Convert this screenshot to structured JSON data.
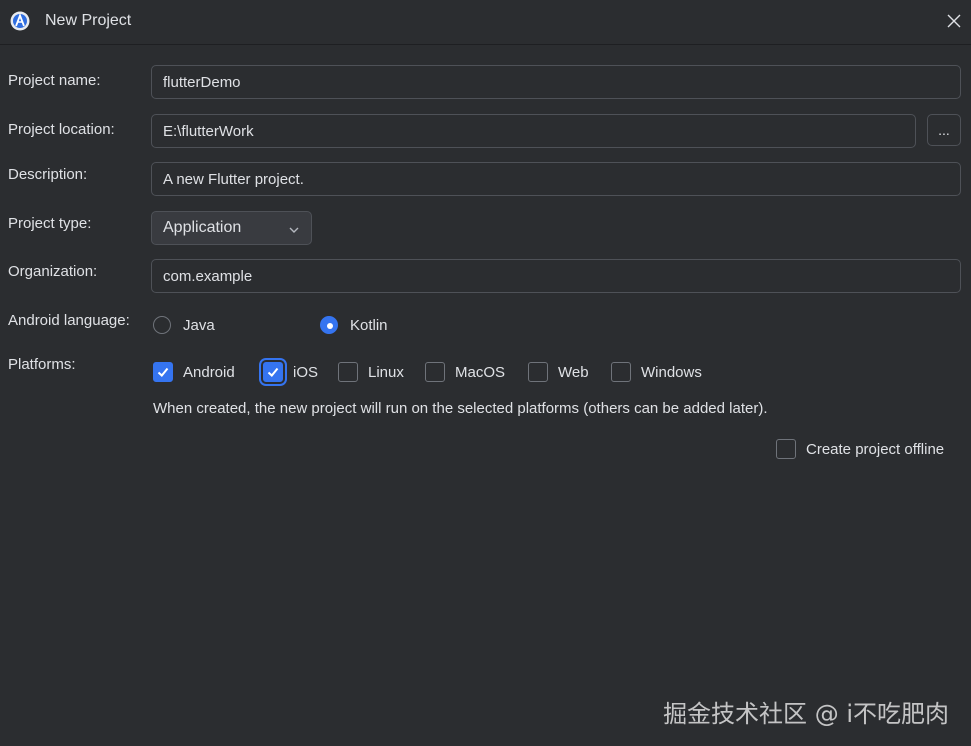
{
  "window": {
    "title": "New Project",
    "icon": "android-studio-icon",
    "close_icon": "close-icon"
  },
  "form": {
    "project_name": {
      "label": "Project name:",
      "value": "flutterDemo"
    },
    "project_location": {
      "label": "Project location:",
      "value": "E:\\flutterWork",
      "browse_label": "..."
    },
    "description": {
      "label": "Description:",
      "value": "A new Flutter project."
    },
    "project_type": {
      "label": "Project type:",
      "selected": "Application"
    },
    "organization": {
      "label": "Organization:",
      "value": "com.example"
    },
    "android_language": {
      "label": "Android language:",
      "options": [
        {
          "label": "Java",
          "checked": false
        },
        {
          "label": "Kotlin",
          "checked": true
        }
      ]
    },
    "platforms": {
      "label": "Platforms:",
      "options": [
        {
          "label": "Android",
          "checked": true
        },
        {
          "label": "iOS",
          "checked": true
        },
        {
          "label": "Linux",
          "checked": false
        },
        {
          "label": "MacOS",
          "checked": false
        },
        {
          "label": "Web",
          "checked": false
        },
        {
          "label": "Windows",
          "checked": false
        }
      ],
      "hint": "When created, the new project will run on the selected platforms (others can be added later)."
    },
    "create_offline": {
      "label": "Create project offline",
      "checked": false
    }
  },
  "watermark": "掘金技术社区 @ i不吃肥肉",
  "colors": {
    "background": "#2b2d30",
    "accent": "#3574f0",
    "border": "#4e5157",
    "text": "#dfe1e5"
  }
}
